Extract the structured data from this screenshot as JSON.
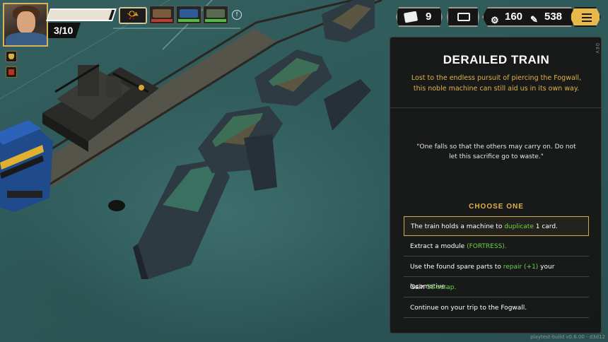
{
  "hud": {
    "crew_count": "3/10",
    "hp_fraction": 0.95,
    "deck_count": "9",
    "scrap": "160",
    "resource_2": "538",
    "info_glyph": "!",
    "icons": [
      "portrait-avatar",
      "horn-icon",
      "cars-icon",
      "deck-icon",
      "map-icon",
      "gear-resource-icon",
      "tools-resource-icon",
      "menu-icon"
    ]
  },
  "event": {
    "dev_tag": "DEV",
    "title": "DERAILED TRAIN",
    "description": "Lost to the endless pursuit of piercing the Fogwall, this noble machine can still aid us in its own way.",
    "quote": "\"One falls so that the others may carry on. Do not let this sacrifice go to waste.\"",
    "choose_heading": "CHOOSE ONE",
    "options": [
      {
        "before": "The train holds a machine to ",
        "highlight": "duplicate",
        "after": " 1 card.",
        "selected": true
      },
      {
        "before": "Extract a module ",
        "highlight": "(FORTRESS).",
        "after": "",
        "selected": false
      },
      {
        "before": "Use the found spare parts to ",
        "highlight": "repair (+1)",
        "after": " your locomotive.",
        "selected": false
      },
      {
        "before": "Gain ",
        "highlight": "50 scrap.",
        "after": "",
        "selected": false
      },
      {
        "before": "Continue on your trip to the Fogwall.",
        "highlight": "",
        "after": "",
        "selected": false
      }
    ]
  },
  "build": "playtest-build v0.6.00 - d3d12",
  "colors": {
    "accent_gold": "#e2b24b",
    "highlight_green": "#6ed34a",
    "panel_bg": "#161614",
    "ground": "#2f5b5b"
  }
}
